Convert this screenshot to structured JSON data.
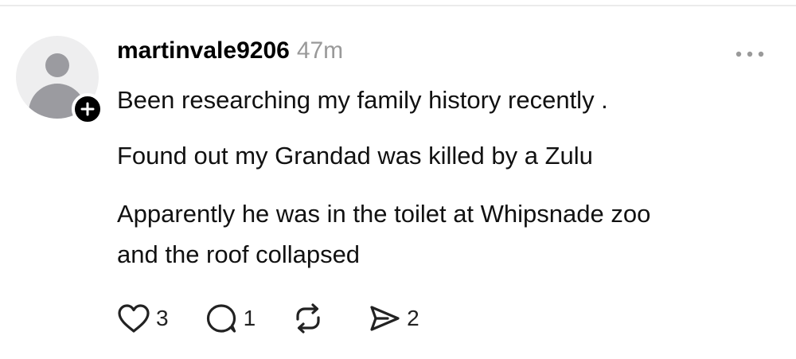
{
  "post": {
    "author": {
      "username": "martinvale9206",
      "timestamp": "47m",
      "avatar_icon": "default-avatar-icon",
      "follow_icon": "plus-icon"
    },
    "more_icon": "more-options-icon",
    "lines": [
      "Been researching my family history recently .",
      "Found out my Grandad was killed by a Zulu",
      "Apparently he was in the toilet at Whipsnade zoo",
      "and the roof collapsed"
    ],
    "actions": {
      "like": {
        "icon": "heart-icon",
        "count": "3"
      },
      "reply": {
        "icon": "comment-icon",
        "count": "1"
      },
      "repost": {
        "icon": "repost-icon",
        "count": ""
      },
      "share": {
        "icon": "send-icon",
        "count": "2"
      }
    }
  },
  "colors": {
    "text": "#111111",
    "muted": "#999999",
    "avatar_bg": "#eeeeef",
    "avatar_fg": "#9b9ba0",
    "divider": "#ebebeb"
  }
}
